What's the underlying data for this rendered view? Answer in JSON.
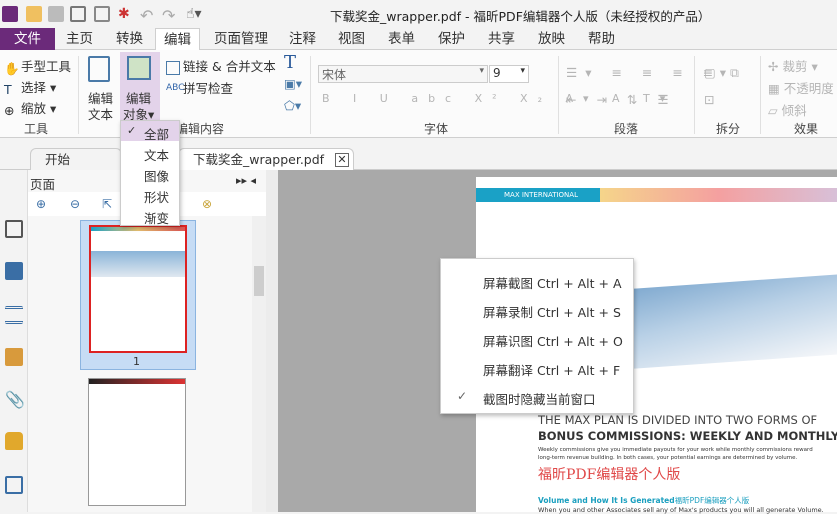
{
  "window": {
    "title": "下载奖金_wrapper.pdf - 福昕PDF编辑器个人版（未经授权的产品）"
  },
  "menu": [
    "文件",
    "主页",
    "转换",
    "编辑",
    "页面管理",
    "注释",
    "视图",
    "表单",
    "保护",
    "共享",
    "放映",
    "帮助"
  ],
  "ribbon": {
    "tools": {
      "hand": "手型工具",
      "select": "选择",
      "zoom": "缩放",
      "group": "工具"
    },
    "edit_text": [
      "编辑",
      "文本"
    ],
    "edit_object": [
      "编辑",
      "对象"
    ],
    "link_merge": "链接 & 合并文本",
    "spellcheck": "拼写检查",
    "edit_group": "编辑内容",
    "font": {
      "name": "宋体",
      "size": "9",
      "group": "字体"
    },
    "paragraph_group": "段落",
    "split_group": "拆分",
    "effects": {
      "crop": "裁剪",
      "opacity": "不透明度",
      "skew": "倾斜",
      "group": "效果"
    }
  },
  "edit_object_dropdown": {
    "items": [
      "全部",
      "文本",
      "图像",
      "形状",
      "渐变"
    ],
    "checked": "全部"
  },
  "doc_tabs": {
    "start": "开始",
    "file": "下载奖金_wrapper.pdf"
  },
  "panel": {
    "title": "页面",
    "page_number": "1"
  },
  "context_menu": {
    "items": [
      "屏幕截图 Ctrl + Alt + A",
      "屏幕录制 Ctrl + Alt + S",
      "屏幕识图 Ctrl + Alt + O",
      "屏幕翻译 Ctrl + Alt + F",
      "截图时隐藏当前窗口"
    ],
    "checked_index": 4
  },
  "pdf": {
    "header": "MAX INTERNATIONAL",
    "heading1": "THE MAX PLAN IS DIVIDED INTO TWO FORMS OF",
    "heading2": "BONUS COMMISSIONS: WEEKLY AND MONTHLY.",
    "body1": "Weekly commissions give you immediate payouts for your work while monthly commissions reward",
    "body2": "long-term revenue building. In both cases, your potential earnings are determined by volume.",
    "watermark": "福昕PDF编辑器个人版",
    "subheading": "Volume and How It Is Generated",
    "sub_watermark": "福昕PDF编辑器个人版",
    "body3": "When you and other Associates sell any of Max's products you will all generate Volume."
  },
  "colors": {
    "file_tab": "#6b2a7a",
    "accent": "#1aa1c6",
    "selection": "#c6dcf5"
  }
}
